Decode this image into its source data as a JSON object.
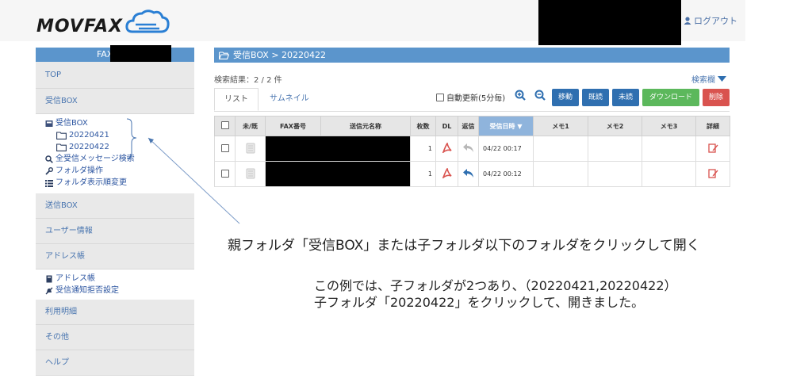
{
  "header": {
    "logo_text": "MOVFAX",
    "logout_label": "ログアウト"
  },
  "sidebar": {
    "fax_label": "FAX番号:",
    "top": "TOP",
    "inbox": "受信BOX",
    "inbox_tree": {
      "root": "受信BOX",
      "folders": [
        "20220421",
        "20220422"
      ],
      "search_all": "全受信メッセージ検索",
      "folder_ops": "フォルダ操作",
      "folder_order": "フォルダ表示順変更"
    },
    "outbox": "送信BOX",
    "user_info": "ユーザー情報",
    "address_book": "アドレス帳",
    "address_sub": {
      "address_book": "アドレス帳",
      "reject": "受信通知拒否設定"
    },
    "usage": "利用明細",
    "other": "その他",
    "help": "ヘルプ"
  },
  "main": {
    "breadcrumb": "受信BOX > 20220422",
    "result_count": "検索結果：2 / 2 件",
    "search_toggle": "検索欄",
    "tabs": {
      "list": "リスト",
      "thumbnail": "サムネイル"
    },
    "auto_refresh": "自動更新(5分毎)",
    "buttons": {
      "move": "移動",
      "read": "既読",
      "unread": "未読",
      "download": "ダウンロード",
      "delete": "削除"
    },
    "colors": {
      "blue_button": "#2f6fb0",
      "download_button": "#5cb85c",
      "delete_button": "#d9534f",
      "title_bar": "#5b95cc"
    },
    "table": {
      "headers": [
        "未/既",
        "FAX番号",
        "送信元名称",
        "枚数",
        "DL",
        "返信",
        "受信日時",
        "メモ1",
        "メモ2",
        "メモ3",
        "詳細"
      ],
      "rows": [
        {
          "pages": "1",
          "received": "04/22 00:17"
        },
        {
          "pages": "1",
          "received": "04/22 00:12"
        }
      ]
    }
  },
  "annotations": {
    "main": "親フォルダ「受信BOX」または子フォルダ以下のフォルダをクリックして開く",
    "line1": "この例では、子フォルダが2つあり、（20220421,20220422）",
    "line2": "子フォルダ「20220422」をクリックして、開きました。"
  }
}
